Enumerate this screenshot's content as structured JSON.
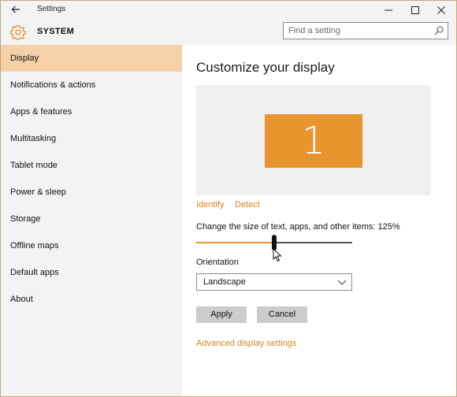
{
  "titlebar": {
    "back_icon": "back-arrow-icon",
    "title": "Settings",
    "minimize_icon": "minimize-icon",
    "maximize_icon": "maximize-icon",
    "close_icon": "close-icon"
  },
  "header": {
    "icon": "gear-icon",
    "section": "SYSTEM",
    "search": {
      "placeholder": "Find a setting",
      "value": "",
      "icon": "search-icon"
    }
  },
  "sidebar": {
    "items": [
      {
        "label": "Display",
        "selected": true
      },
      {
        "label": "Notifications & actions",
        "selected": false
      },
      {
        "label": "Apps & features",
        "selected": false
      },
      {
        "label": "Multitasking",
        "selected": false
      },
      {
        "label": "Tablet mode",
        "selected": false
      },
      {
        "label": "Power & sleep",
        "selected": false
      },
      {
        "label": "Storage",
        "selected": false
      },
      {
        "label": "Offline maps",
        "selected": false
      },
      {
        "label": "Default apps",
        "selected": false
      },
      {
        "label": "About",
        "selected": false
      }
    ]
  },
  "main": {
    "heading": "Customize your display",
    "monitor_number": "1",
    "identify_link": "Identify",
    "detect_link": "Detect",
    "scale_label": "Change the size of text, apps, and other items: 125%",
    "scale_slider_fraction": 0.5,
    "orientation_label": "Orientation",
    "orientation_value": "Landscape",
    "apply_button": "Apply",
    "cancel_button": "Cancel",
    "advanced_link": "Advanced display settings"
  },
  "colors": {
    "accent": "#e8952f",
    "accent_link": "#d4831d",
    "selected_nav": "#f6d1a8",
    "chrome": "#f3f3f3"
  }
}
